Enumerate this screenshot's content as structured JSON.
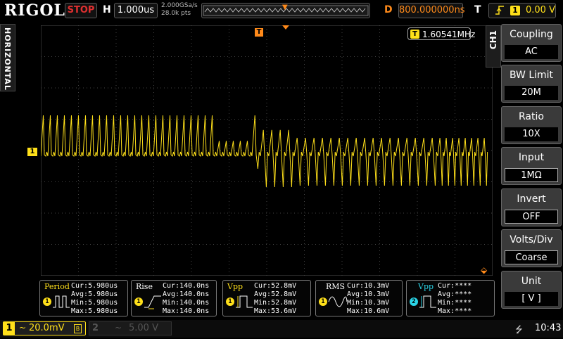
{
  "topbar": {
    "logo": "RIGOL",
    "run_state": "STOP",
    "h_label": "H",
    "timebase": "1.000us",
    "sample_rate": "2.000GSa/s",
    "memory_depth": "28.0k pts",
    "d_label": "D",
    "delay": "800.000000ns",
    "t_label": "T",
    "trigger_source": "1",
    "trigger_level": "0.00 V"
  },
  "left_tab": "HORIZONTAL",
  "frequency_counter": {
    "badge": "T",
    "value": "1.60541MHz"
  },
  "channel_marker": "1",
  "right_tab": "CH1",
  "menu": [
    {
      "title": "Coupling",
      "value": "AC"
    },
    {
      "title": "BW Limit",
      "value": "20M"
    },
    {
      "title": "Ratio",
      "value": "10X"
    },
    {
      "title": "Input",
      "value": "1MΩ"
    },
    {
      "title": "Invert",
      "value": "OFF"
    },
    {
      "title": "Volts/Div",
      "value": "Coarse"
    },
    {
      "title": "Unit",
      "value": "[ V ]"
    }
  ],
  "measurements": [
    {
      "name": "Period",
      "channel": "1",
      "cur": "Cur:5.980us",
      "avg": "Avg:5.980us",
      "min": "Min:5.980us",
      "max": "Max:5.980us"
    },
    {
      "name": "Rise",
      "channel": "1",
      "cur": "Cur:140.0ns",
      "avg": "Avg:140.0ns",
      "min": "Min:140.0ns",
      "max": "Max:140.0ns"
    },
    {
      "name": "Vpp",
      "channel": "1",
      "cur": "Cur:52.8mV",
      "avg": "Avg:52.8mV",
      "min": "Min:52.8mV",
      "max": "Max:53.6mV"
    },
    {
      "name": "RMS",
      "channel": "1",
      "cur": "Cur:10.3mV",
      "avg": "Avg:10.3mV",
      "min": "Min:10.3mV",
      "max": "Max:10.6mV"
    },
    {
      "name": "Vpp",
      "channel": "2",
      "cur": "Cur:****",
      "avg": "Avg:****",
      "min": "Min:****",
      "max": "Max:****"
    }
  ],
  "bottombar": {
    "ch1": {
      "num": "1",
      "coupling": "~",
      "scale": "20.0mV",
      "bw": "B"
    },
    "ch2": {
      "num": "2",
      "coupling": "~",
      "scale": "5.00 V"
    },
    "time": "10:43"
  },
  "colors": {
    "ch1": "#ffe01a",
    "ch2": "#2ad4e6",
    "trigger": "#ff8a1a",
    "stop": "#e03030"
  }
}
